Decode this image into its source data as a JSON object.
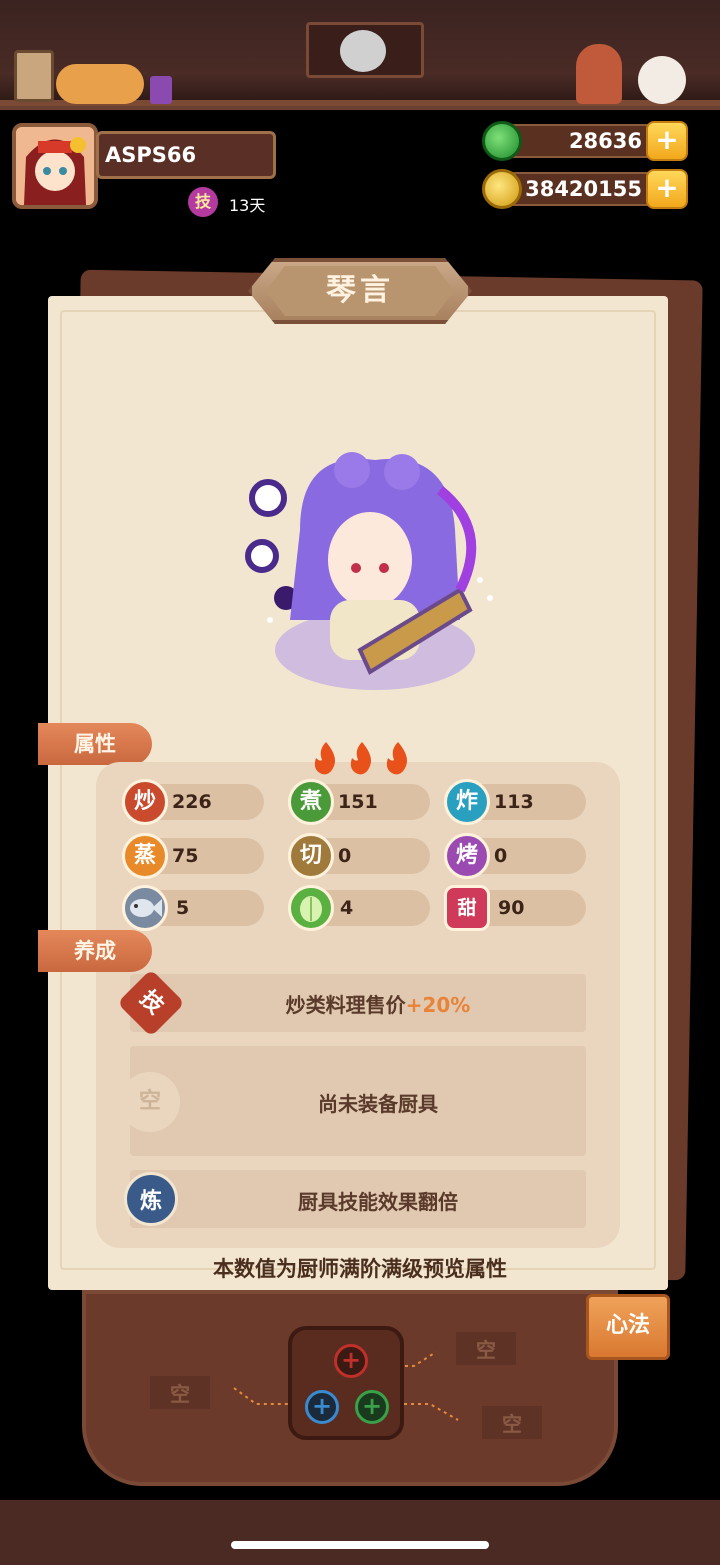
{
  "header": {
    "player_name": "ASPS66",
    "skill_badge": "技",
    "skill_days": "13天",
    "jade": "28636",
    "coins": "38420155",
    "plus": "+"
  },
  "panel": {
    "title": "琴言",
    "attr_tag": "属性",
    "cultivate_tag": "养成",
    "stats": [
      {
        "icon": "炒",
        "value": "226",
        "color": "#c94a2c"
      },
      {
        "icon": "煮",
        "value": "151",
        "color": "#4a9a3a"
      },
      {
        "icon": "炸",
        "value": "113",
        "color": "#2aa0c0"
      },
      {
        "icon": "蒸",
        "value": "75",
        "color": "#e88a2a"
      },
      {
        "icon": "切",
        "value": "0",
        "color": "#a07a3a"
      },
      {
        "icon": "烤",
        "value": "0",
        "color": "#9a4ab0"
      },
      {
        "icon": "fish-icon",
        "value": "5",
        "color": "#7a8aa0"
      },
      {
        "icon": "cabbage-icon",
        "value": "4",
        "color": "#5ab040"
      },
      {
        "icon": "甜",
        "value": "90",
        "color": "#d03a5a"
      }
    ],
    "skill_icon": "技",
    "skill_text": "炒类料理售价",
    "skill_bonus": "+20%",
    "equip_icon": "空",
    "equip_text": "尚未装备厨具",
    "refine_icon": "炼",
    "refine_text": "厨具技能效果翻倍",
    "footnote": "本数值为厨师满阶满级预览属性"
  },
  "tray": {
    "slot_left": "空",
    "slot_top_right": "空",
    "slot_bottom_right": "空",
    "xinfa": "心法",
    "hub_plus": "+"
  },
  "colors": {
    "panel_bg": "#f3e6d1",
    "accent_orange": "#e8833a",
    "frame_brown": "#6b3a2a"
  }
}
